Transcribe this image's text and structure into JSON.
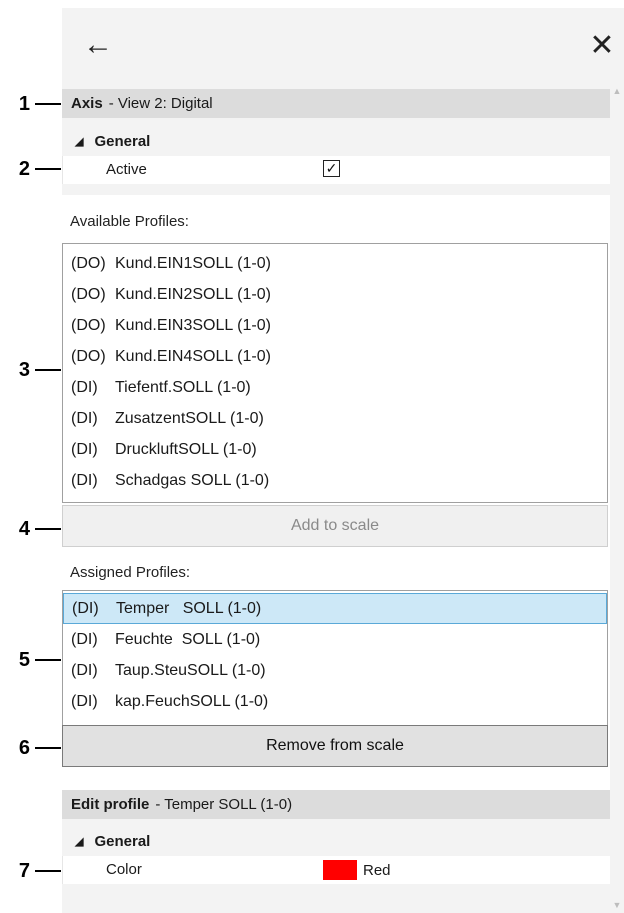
{
  "header": {
    "back_icon": "arrow-left-icon",
    "close_icon": "close-icon"
  },
  "axis_section": {
    "title": "Axis",
    "subtitle": "- View 2: Digital"
  },
  "general_group": {
    "label": "General",
    "active_label": "Active",
    "active_checked": true,
    "check_glyph": "✓"
  },
  "available": {
    "caption": "Available Profiles:",
    "items": [
      {
        "prefix": "(DO)",
        "name": "Kund.EIN1SOLL (1-0)"
      },
      {
        "prefix": "(DO)",
        "name": "Kund.EIN2SOLL (1-0)"
      },
      {
        "prefix": "(DO)",
        "name": "Kund.EIN3SOLL (1-0)"
      },
      {
        "prefix": "(DO)",
        "name": "Kund.EIN4SOLL (1-0)"
      },
      {
        "prefix": "(DI)",
        "name": "Tiefentf.SOLL (1-0)"
      },
      {
        "prefix": "(DI)",
        "name": "ZusatzentSOLL (1-0)"
      },
      {
        "prefix": "(DI)",
        "name": "DruckluftSOLL (1-0)"
      },
      {
        "prefix": "(DI)",
        "name": "Schadgas SOLL (1-0)"
      }
    ],
    "add_button": "Add to scale"
  },
  "assigned": {
    "caption": "Assigned Profiles:",
    "items": [
      {
        "prefix": "(DI)",
        "name": "Temper   SOLL (1-0)",
        "selected": true
      },
      {
        "prefix": "(DI)",
        "name": "Feuchte  SOLL (1-0)"
      },
      {
        "prefix": "(DI)",
        "name": "Taup.SteuSOLL (1-0)"
      },
      {
        "prefix": "(DI)",
        "name": "kap.FeuchSOLL (1-0)"
      }
    ],
    "remove_button": "Remove from scale"
  },
  "edit_profile": {
    "title": "Edit profile",
    "subtitle": "- Temper   SOLL (1-0)",
    "group_label": "General",
    "color_label": "Color",
    "color_value": "Red",
    "color_hex": "#ff0000"
  },
  "callouts": [
    "1",
    "2",
    "3",
    "4",
    "5",
    "6",
    "7"
  ],
  "colors": {
    "selection_bg": "#cde8f7",
    "selection_border": "#5aa9d8",
    "header_bg": "#dcdcdc",
    "panel_bg": "#f3f3f3"
  }
}
